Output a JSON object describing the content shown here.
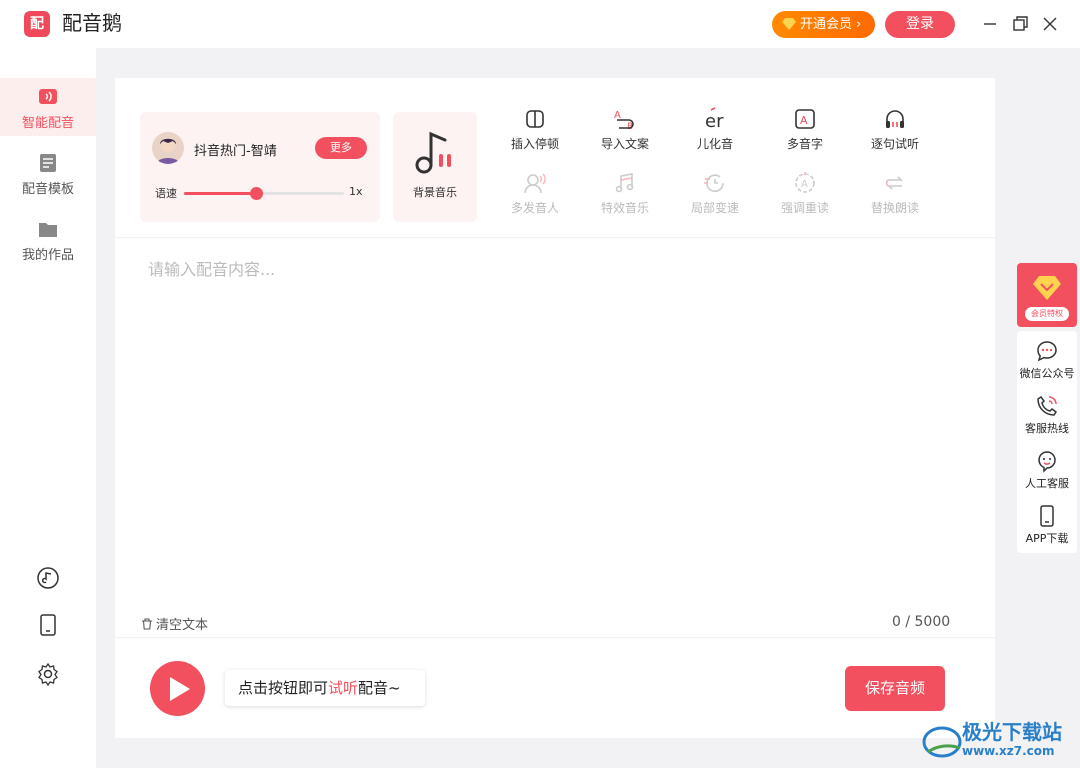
{
  "app": {
    "logo_char": "配",
    "title": "配音鹅"
  },
  "header": {
    "vip_label": "开通会员",
    "login_label": "登录"
  },
  "sidebar": {
    "items": [
      {
        "label": "智能配音",
        "icon": "voice-wave-icon",
        "active": true
      },
      {
        "label": "配音模板",
        "icon": "document-icon",
        "active": false
      },
      {
        "label": "我的作品",
        "icon": "folder-icon",
        "active": false
      }
    ],
    "bottom_icons": [
      "music-disc-icon",
      "phone-icon",
      "settings-icon"
    ]
  },
  "voice": {
    "name": "抖音热门-智靖",
    "more_label": "更多",
    "speed_label": "语速",
    "speed_value": "1x",
    "speed_level": 0.45
  },
  "bgm": {
    "label": "背景音乐"
  },
  "tools": [
    {
      "label": "插入停顿",
      "icon": "pause-block-icon",
      "enabled": true
    },
    {
      "label": "导入文案",
      "icon": "import-ab-icon",
      "enabled": true
    },
    {
      "label": "儿化音",
      "icon": "er-icon",
      "enabled": true
    },
    {
      "label": "多音字",
      "icon": "polyphone-icon",
      "enabled": true
    },
    {
      "label": "逐句试听",
      "icon": "headphones-icon",
      "enabled": true
    },
    {
      "label": "多发音人",
      "icon": "multi-speaker-icon",
      "enabled": false
    },
    {
      "label": "特效音乐",
      "icon": "effect-music-icon",
      "enabled": false
    },
    {
      "label": "局部变速",
      "icon": "speed-change-icon",
      "enabled": false
    },
    {
      "label": "强调重读",
      "icon": "emphasis-icon",
      "enabled": false
    },
    {
      "label": "替换朗读",
      "icon": "replace-icon",
      "enabled": false
    }
  ],
  "editor": {
    "placeholder": "请输入配音内容...",
    "clear_label": "清空文本",
    "counter": "0 / 5000"
  },
  "player": {
    "hint_prefix": "点击按钮即可",
    "hint_highlight": "试听",
    "hint_suffix": "配音~",
    "save_label": "保存音频"
  },
  "float": {
    "vip_tag": "会员特权",
    "items": [
      {
        "label": "微信公众号",
        "icon": "chat-bubble-icon"
      },
      {
        "label": "客服热线",
        "icon": "phone-call-icon"
      },
      {
        "label": "人工客服",
        "icon": "service-face-icon"
      },
      {
        "label": "APP下载",
        "icon": "mobile-icon"
      }
    ]
  },
  "watermark": {
    "text": "极光下载站",
    "url": "www.xz7.com"
  },
  "colors": {
    "accent": "#f2505e",
    "vip": "#ff7a00"
  }
}
